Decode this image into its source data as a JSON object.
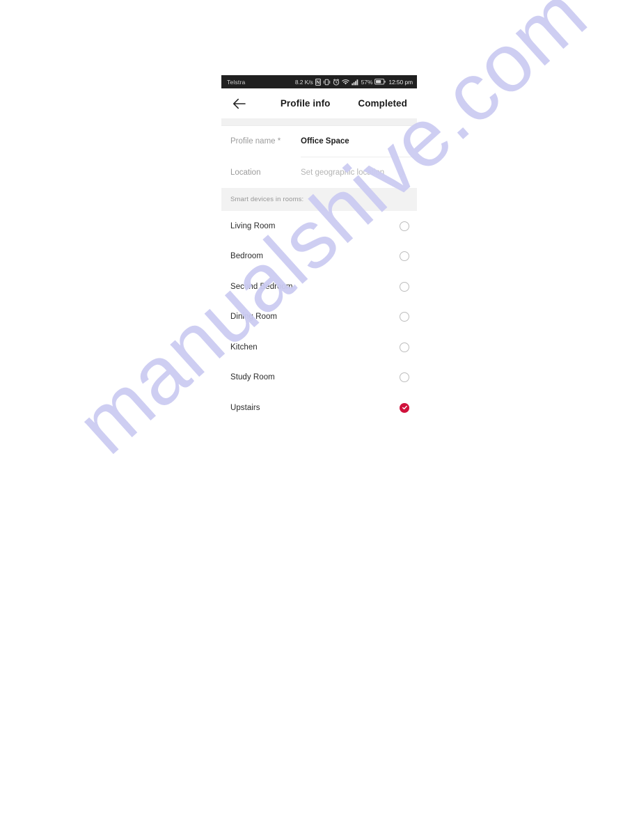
{
  "watermark": {
    "text": "manualshive.com",
    "color": "#ccccf2"
  },
  "statusbar": {
    "carrier": "Telstra",
    "network_speed": "8.2 K/s",
    "icons": [
      "nfc-icon",
      "vibrate-icon",
      "alarm-icon",
      "wifi-icon",
      "signal-icon"
    ],
    "battery_percent": "57%",
    "clock": "12:50 pm"
  },
  "appbar": {
    "back_icon": "back-arrow-icon",
    "title": "Profile info",
    "action_label": "Completed"
  },
  "form": {
    "profile_name": {
      "label": "Profile name *",
      "value": "Office Space"
    },
    "location": {
      "label": "Location",
      "placeholder": "Set geographic location",
      "chevron_icon": "chevron-right-icon"
    }
  },
  "rooms_section": {
    "header": "Smart devices in rooms:",
    "selected_color": "#d0123c",
    "items": [
      {
        "label": "Living Room",
        "selected": false
      },
      {
        "label": "Bedroom",
        "selected": false
      },
      {
        "label": "Second Bedroom",
        "selected": false
      },
      {
        "label": "Dining Room",
        "selected": false
      },
      {
        "label": "Kitchen",
        "selected": false
      },
      {
        "label": "Study Room",
        "selected": false
      },
      {
        "label": "Upstairs",
        "selected": true
      }
    ]
  }
}
